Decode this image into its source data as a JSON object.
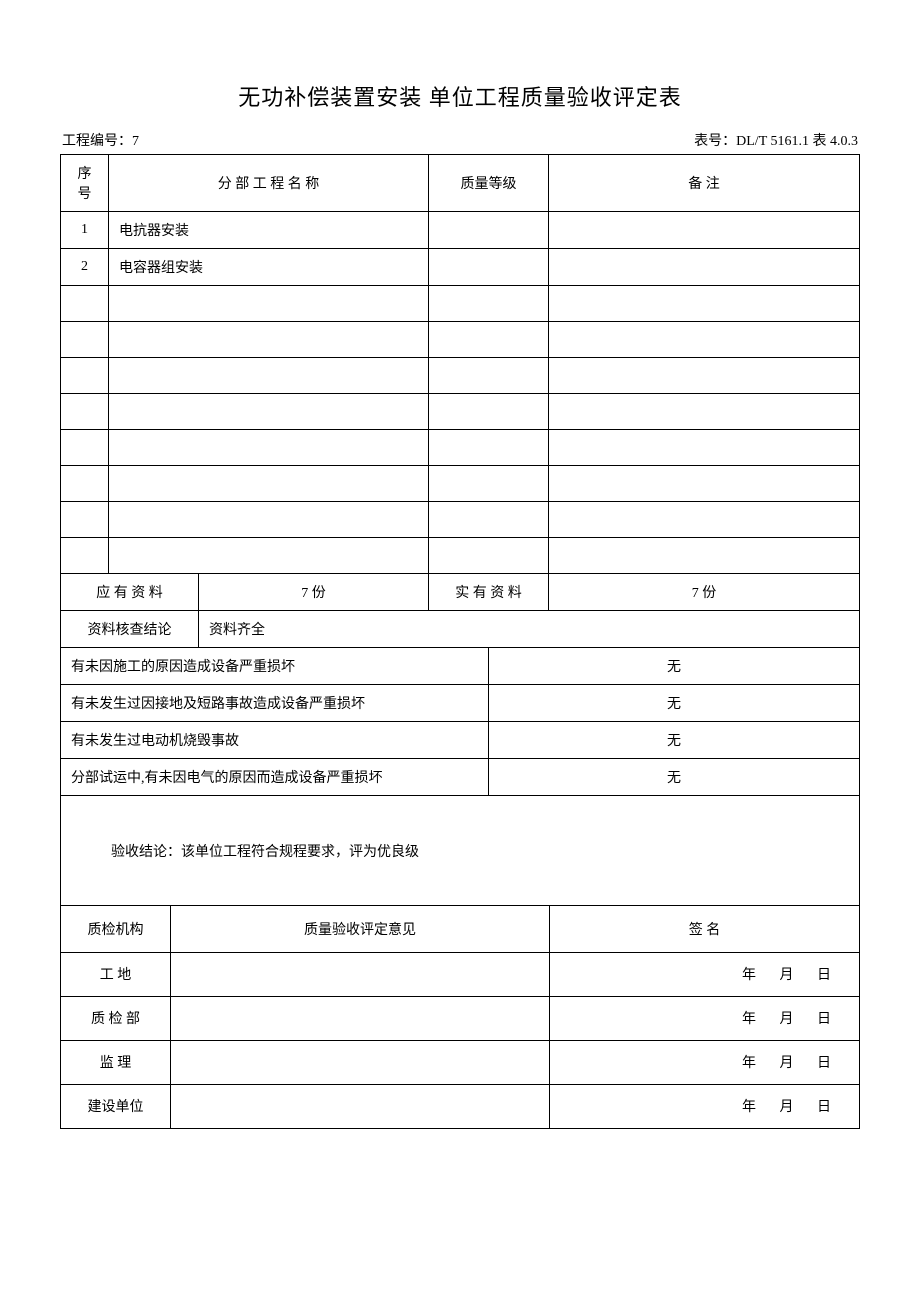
{
  "title": "无功补偿装置安装  单位工程质量验收评定表",
  "meta": {
    "project_no_label": "工程编号：",
    "project_no_value": "7",
    "form_no_label": "表号：",
    "form_no_value": "DL/T 5161.1  表 4.0.3"
  },
  "headers": {
    "seq": "序号",
    "name": "分 部 工 程 名 称",
    "grade": "质量等级",
    "note": "备        注"
  },
  "rows": [
    {
      "seq": "1",
      "name": "电抗器安装",
      "grade": "",
      "note": ""
    },
    {
      "seq": "2",
      "name": "电容器组安装",
      "grade": "",
      "note": ""
    },
    {
      "seq": "",
      "name": "",
      "grade": "",
      "note": ""
    },
    {
      "seq": "",
      "name": "",
      "grade": "",
      "note": ""
    },
    {
      "seq": "",
      "name": "",
      "grade": "",
      "note": ""
    },
    {
      "seq": "",
      "name": "",
      "grade": "",
      "note": ""
    },
    {
      "seq": "",
      "name": "",
      "grade": "",
      "note": ""
    },
    {
      "seq": "",
      "name": "",
      "grade": "",
      "note": ""
    },
    {
      "seq": "",
      "name": "",
      "grade": "",
      "note": ""
    },
    {
      "seq": "",
      "name": "",
      "grade": "",
      "note": ""
    }
  ],
  "materials": {
    "should_label": "应 有 资 料",
    "should_value": "7 份",
    "actual_label": "实 有 资 料",
    "actual_value": "7 份",
    "check_label": "资料核查结论",
    "check_value": "资料齐全"
  },
  "questions": [
    {
      "q": "有未因施工的原因造成设备严重损坏",
      "a": "无"
    },
    {
      "q": "有未发生过因接地及短路事故造成设备严重损坏",
      "a": "无"
    },
    {
      "q": "有未发生过电动机烧毁事故",
      "a": "无"
    },
    {
      "q": "分部试运中,有未因电气的原因而造成设备严重损坏",
      "a": "无"
    }
  ],
  "conclusion": "验收结论：该单位工程符合规程要求，评为优良级",
  "sig_headers": {
    "org": "质检机构",
    "opinion": "质量验收评定意见",
    "sign": "签       名"
  },
  "sig_rows": [
    {
      "org": "工    地",
      "date": "年  月  日"
    },
    {
      "org": "质 检 部",
      "date": "年  月  日"
    },
    {
      "org": "监    理",
      "date": "年  月  日"
    },
    {
      "org": "建设单位",
      "date": "年  月  日"
    }
  ]
}
